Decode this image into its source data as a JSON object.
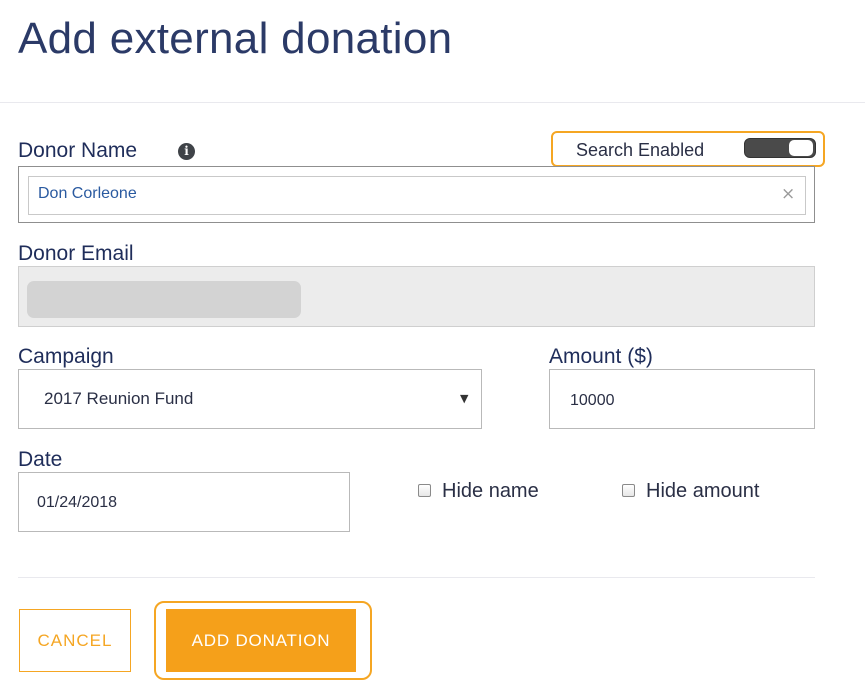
{
  "page": {
    "title": "Add external donation"
  },
  "donor_name": {
    "label": "Donor Name",
    "info_icon": "info-circle-icon",
    "value": "Don Corleone",
    "clear_glyph": "×",
    "clear_icon": "close-icon"
  },
  "search_toggle": {
    "label": "Search Enabled",
    "enabled": true,
    "highlight_color": "#f5a623"
  },
  "donor_email": {
    "label": "Donor Email",
    "value": ""
  },
  "campaign": {
    "label": "Campaign",
    "selected": "2017 Reunion Fund",
    "arrow_glyph": "▼"
  },
  "amount": {
    "label": "Amount ($)",
    "value": "10000"
  },
  "date": {
    "label": "Date",
    "value": "01/24/2018"
  },
  "options": {
    "hide_name_label": "Hide name",
    "hide_name_checked": false,
    "hide_amount_label": "Hide amount",
    "hide_amount_checked": false
  },
  "actions": {
    "cancel_label": "CANCEL",
    "add_label": "ADD DONATION",
    "accent_color": "#f5a623"
  }
}
